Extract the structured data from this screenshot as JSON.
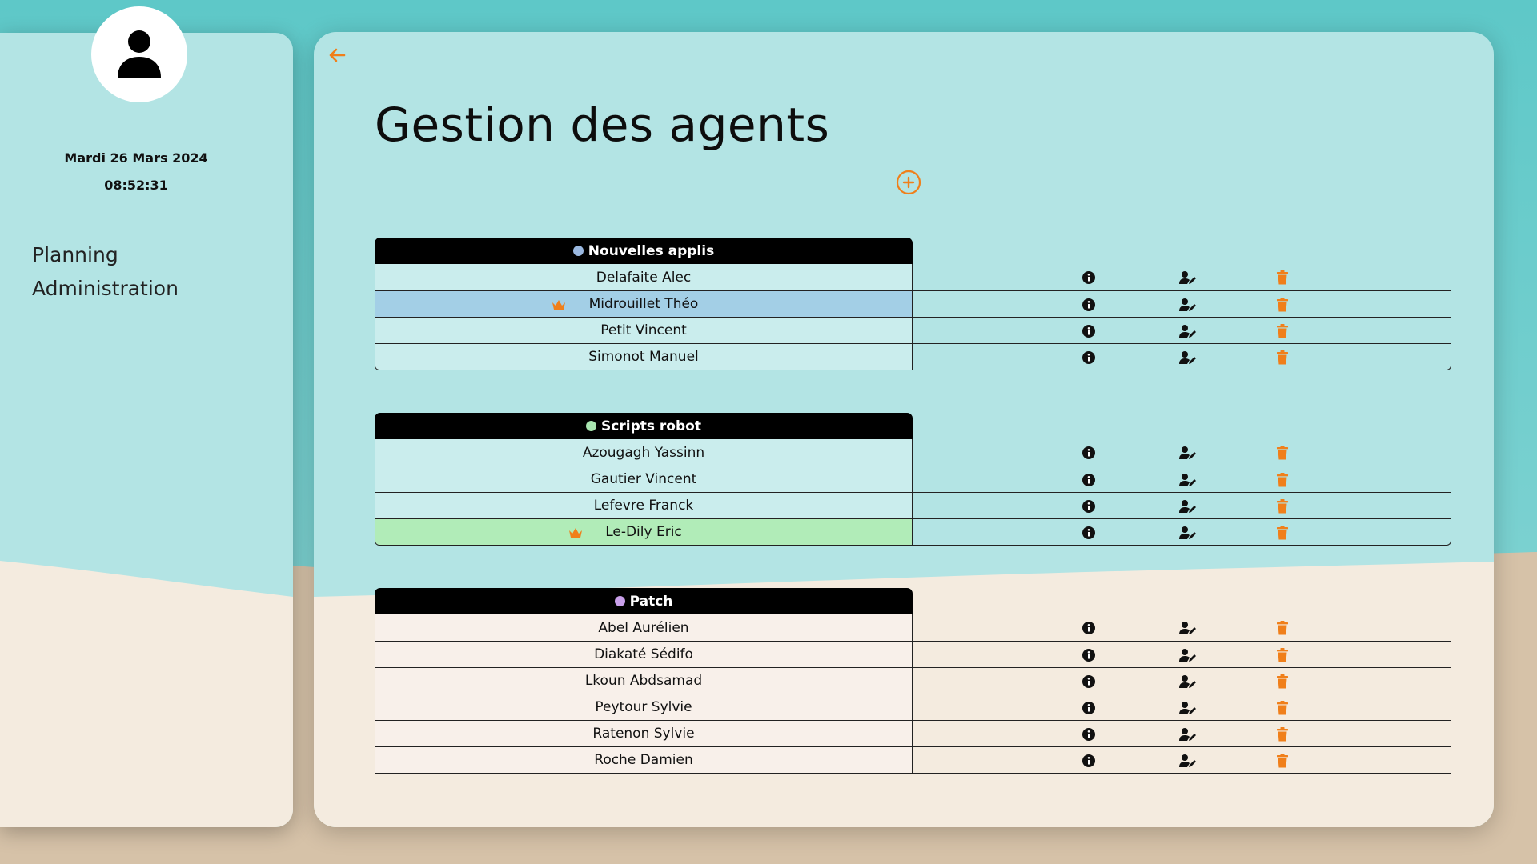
{
  "sidebar": {
    "date": "Mardi 26 Mars 2024",
    "time": "08:52:31",
    "nav": [
      {
        "label": "Planning"
      },
      {
        "label": "Administration"
      }
    ]
  },
  "main": {
    "title": "Gestion des agents",
    "groups": [
      {
        "name": "Nouvelles applis",
        "dot_color": "#9ab8e0",
        "rows": [
          {
            "name": "Delafaite Alec",
            "leader": false
          },
          {
            "name": "Midrouillet Théo",
            "leader": true
          },
          {
            "name": "Petit Vincent",
            "leader": false
          },
          {
            "name": "Simonot Manuel",
            "leader": false
          }
        ]
      },
      {
        "name": "Scripts robot",
        "dot_color": "#a8e6b0",
        "rows": [
          {
            "name": "Azougagh Yassinn",
            "leader": false
          },
          {
            "name": "Gautier Vincent",
            "leader": false
          },
          {
            "name": "Lefevre Franck",
            "leader": false
          },
          {
            "name": "Le-Dily Eric",
            "leader": true
          }
        ]
      },
      {
        "name": "Patch",
        "dot_color": "#c9a0ea",
        "rows": [
          {
            "name": "Abel Aurélien",
            "leader": false
          },
          {
            "name": "Diakaté Sédifo",
            "leader": false
          },
          {
            "name": "Lkoun Abdsamad",
            "leader": false
          },
          {
            "name": "Peytour Sylvie",
            "leader": false
          },
          {
            "name": "Ratenon Sylvie",
            "leader": false
          },
          {
            "name": "Roche Damien",
            "leader": false
          }
        ]
      }
    ]
  },
  "colors": {
    "accent": "#f07f1a",
    "sea": "#67cbcb",
    "panel_sea": "#b3e4e4",
    "sand": "#f4ebdf",
    "leader_row_group1": "#a3cfe6",
    "leader_row_group2": "#b1ecb8"
  },
  "icons": {
    "back": "arrow-left-icon",
    "add": "plus-circle-icon",
    "info": "info-circle-icon",
    "edit": "user-edit-icon",
    "delete": "trash-icon",
    "leader": "crown-icon",
    "avatar": "user-icon"
  }
}
